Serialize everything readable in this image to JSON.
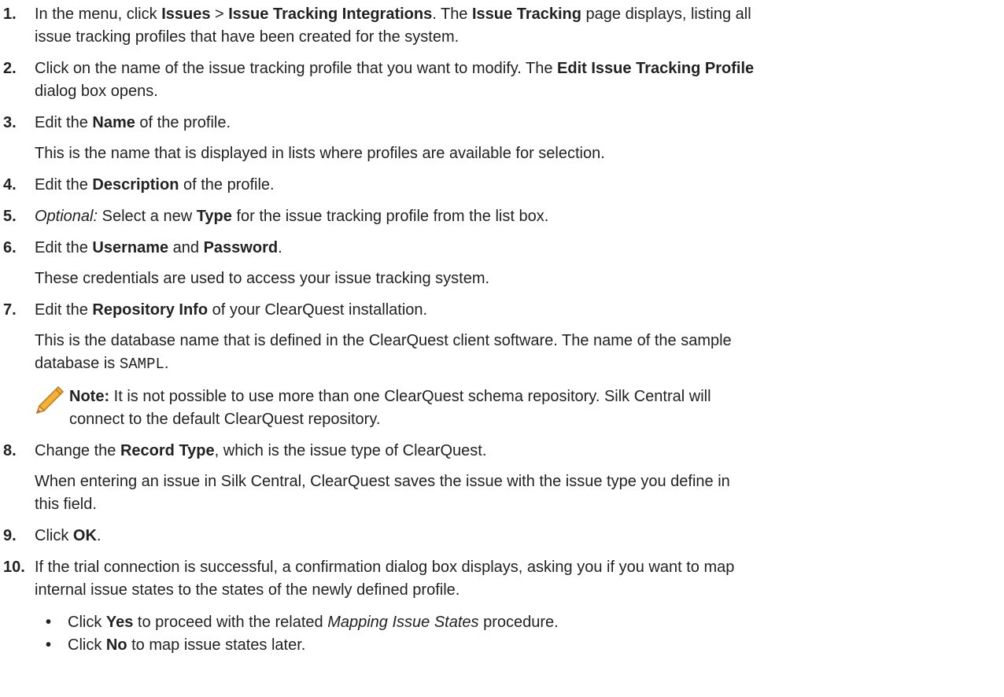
{
  "steps": [
    {
      "num": "1.",
      "parts": [
        {
          "t": "In the menu, click "
        },
        {
          "b": "Issues"
        },
        {
          "t": " > "
        },
        {
          "b": "Issue Tracking Integrations"
        },
        {
          "t": ". The "
        },
        {
          "b": "Issue Tracking"
        },
        {
          "t": " page displays, listing all issue tracking profiles that have been created for the system."
        }
      ],
      "line1": "In the menu, click ",
      "b1": "Issues",
      "t2": " > ",
      "b2": "Issue Tracking Integrations",
      "t3": ". The ",
      "b3": "Issue Tracking",
      "t4": " page displays, listing all",
      "line2": "issue tracking profiles that have been created for the system."
    },
    {
      "num": "2.",
      "t1": "Click on the name of the issue tracking profile that you want to modify. The ",
      "b1": "Edit Issue Tracking Profile",
      "line2": "dialog box opens."
    },
    {
      "num": "3.",
      "t1": "Edit the ",
      "b1": "Name",
      "t2": " of the profile.",
      "para": "This is the name that is displayed in lists where profiles are available for selection."
    },
    {
      "num": "4.",
      "t1": "Edit the ",
      "b1": "Description",
      "t2": " of the profile."
    },
    {
      "num": "5.",
      "i1": "Optional:",
      "t1": " Select a new ",
      "b1": "Type",
      "t2": " for the issue tracking profile from the list box."
    },
    {
      "num": "6.",
      "t1": "Edit the ",
      "b1": "Username",
      "t2": " and ",
      "b2": "Password",
      "t3": ".",
      "para": "These credentials are used to access your issue tracking system."
    },
    {
      "num": "7.",
      "t1": "Edit the ",
      "b1": "Repository Info",
      "t2": " of your ClearQuest installation.",
      "para1": "This is the database name that is defined in the ClearQuest client software. The name of the sample",
      "para2a": "database is ",
      "code": "SAMPL",
      "para2b": ".",
      "note_label": "Note:",
      "note1": " It is not possible to use more than one ClearQuest schema repository. Silk Central will",
      "note2": "connect to the default ClearQuest repository."
    },
    {
      "num": "8.",
      "t1": "Change the ",
      "b1": "Record Type",
      "t2": ", which is the issue type of ClearQuest.",
      "para1": "When entering an issue in Silk Central, ClearQuest saves the issue with the issue type you define in",
      "para2": "this field."
    },
    {
      "num": "9.",
      "t1": "Click ",
      "b1": "OK",
      "t2": "."
    },
    {
      "num": "10.",
      "line1": "If the trial connection is successful, a confirmation dialog box displays, asking you if you want to map",
      "line2": "internal issue states to the states of the newly defined profile.",
      "bullets": [
        {
          "t1": "Click ",
          "b1": "Yes",
          "t2": " to proceed with the related ",
          "i1": "Mapping Issue States",
          "t3": " procedure."
        },
        {
          "t1": "Click ",
          "b1": "No",
          "t2": " to map issue states later."
        }
      ]
    }
  ],
  "bullet_char": "•",
  "note_icon": "pencil-icon",
  "colors": {
    "text": "#222222",
    "pencil_body": "#f0a020",
    "pencil_tip": "#e8503a"
  }
}
